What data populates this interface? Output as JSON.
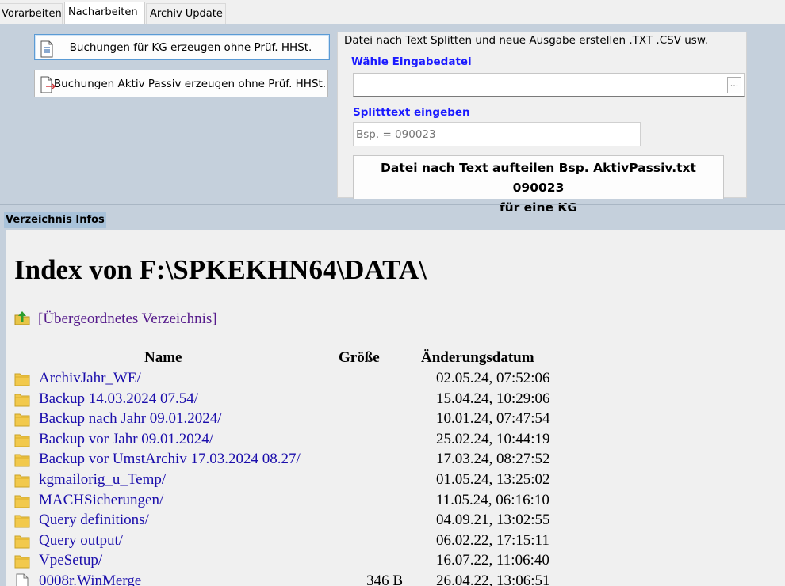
{
  "tabs": [
    {
      "label": "Vorarbeiten"
    },
    {
      "label": "Nacharbeiten"
    },
    {
      "label": "Archiv Update"
    }
  ],
  "actions": {
    "kg_button": "Buchungen für KG erzeugen ohne Prüf. HHSt.",
    "aktiv_passiv_button": "Buchungen Aktiv Passiv erzeugen ohne Prüf. HHSt."
  },
  "split_group": {
    "title": "Datei nach Text Splitten und neue Ausgabe erstellen  .TXT .CSV usw.",
    "input_file_label": "Wähle Eingabedatei",
    "input_file_value": "",
    "browse_label": "...",
    "split_text_label": "Splitttext eingeben",
    "split_text_placeholder": "Bsp. = 090023",
    "split_button_line1": "Datei nach Text aufteilen Bsp. AktivPassiv.txt 090023",
    "split_button_line2": "für eine KG"
  },
  "dir_section": {
    "label": "Verzeichnis Infos"
  },
  "listing": {
    "title": "Index von F:\\SPKEKHN64\\DATA\\",
    "parent_link": "[Übergeordnetes Verzeichnis]",
    "headers": {
      "name": "Name",
      "size": "Größe",
      "date": "Änderungsdatum"
    },
    "entries": [
      {
        "name": "ArchivJahr_WE/",
        "size": "",
        "date": "02.05.24, 07:52:06",
        "icon": "folder-icon"
      },
      {
        "name": "Backup 14.03.2024 07.54/",
        "size": "",
        "date": "15.04.24, 10:29:06",
        "icon": "folder-icon"
      },
      {
        "name": "Backup nach Jahr 09.01.2024/",
        "size": "",
        "date": "10.01.24, 07:47:54",
        "icon": "folder-icon"
      },
      {
        "name": "Backup vor Jahr 09.01.2024/",
        "size": "",
        "date": "25.02.24, 10:44:19",
        "icon": "folder-icon"
      },
      {
        "name": "Backup vor UmstArchiv 17.03.2024 08.27/",
        "size": "",
        "date": "17.03.24, 08:27:52",
        "icon": "folder-icon"
      },
      {
        "name": "kgmailorig_u_Temp/",
        "size": "",
        "date": "01.05.24, 13:25:02",
        "icon": "folder-icon"
      },
      {
        "name": "MACHSicherungen/",
        "size": "",
        "date": "11.05.24, 06:16:10",
        "icon": "folder-icon"
      },
      {
        "name": "Query definitions/",
        "size": "",
        "date": "04.09.21, 13:02:55",
        "icon": "folder-icon"
      },
      {
        "name": "Query output/",
        "size": "",
        "date": "06.02.22, 17:15:11",
        "icon": "folder-icon"
      },
      {
        "name": "VpeSetup/",
        "size": "",
        "date": "16.07.22, 11:06:40",
        "icon": "folder-icon"
      },
      {
        "name": "0008r.WinMerge",
        "size": "346 B",
        "date": "26.04.22, 13:06:51",
        "icon": "file-icon"
      }
    ]
  },
  "colors": {
    "background": "#c5d0dc",
    "label_blue": "#1a1aff",
    "link": "#1a0dab",
    "visited_link": "#551a8b"
  }
}
